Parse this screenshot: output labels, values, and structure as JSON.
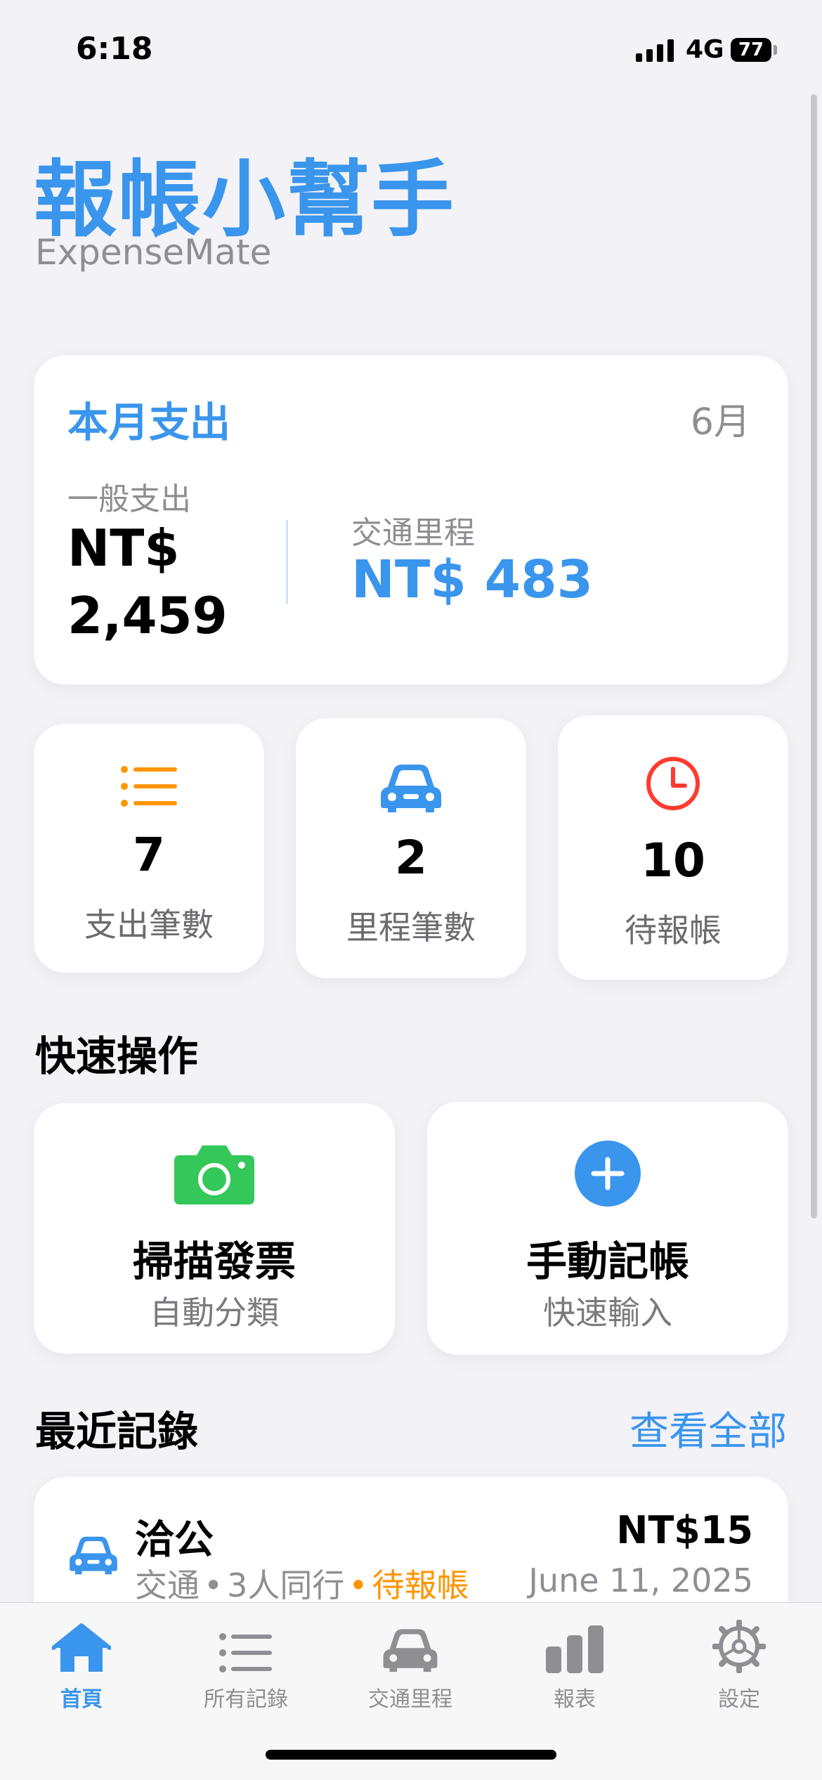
{
  "status_bar": {
    "time": "6:18",
    "network": "4G",
    "battery": "77"
  },
  "header": {
    "title": "報帳小幫手",
    "subtitle": "ExpenseMate"
  },
  "summary": {
    "title": "本月支出",
    "month": "6月",
    "general_label": "一般支出",
    "general_amount": "NT$ 2,459",
    "mileage_label": "交通里程",
    "mileage_amount": "NT$ 483"
  },
  "stats": [
    {
      "icon": "list-icon",
      "value": "7",
      "label": "支出筆數",
      "color": "#ff9500"
    },
    {
      "icon": "car-icon",
      "value": "2",
      "label": "里程筆數",
      "color": "#3a95ec"
    },
    {
      "icon": "clock-icon",
      "value": "10",
      "label": "待報帳",
      "color": "#ff3b30"
    }
  ],
  "quick_actions": {
    "title": "快速操作",
    "items": [
      {
        "icon": "camera-icon",
        "title": "掃描發票",
        "subtitle": "自動分類",
        "color": "#34c759"
      },
      {
        "icon": "plus-circle-icon",
        "title": "手動記帳",
        "subtitle": "快速輸入",
        "color": "#3a95ec"
      }
    ]
  },
  "recent": {
    "title": "最近記錄",
    "see_all": "查看全部",
    "items": [
      {
        "icon": "car-icon",
        "title": "洽公",
        "category": "交通",
        "people": "3人同行",
        "status": "待報帳",
        "amount": "NT$15",
        "date": "June 11, 2025"
      }
    ]
  },
  "tabbar": {
    "active_color": "#3a95ec",
    "items": [
      {
        "icon": "house-icon",
        "label": "首頁",
        "active": true
      },
      {
        "icon": "list-icon",
        "label": "所有記錄",
        "active": false
      },
      {
        "icon": "car-icon",
        "label": "交通里程",
        "active": false
      },
      {
        "icon": "bar-chart-icon",
        "label": "報表",
        "active": false
      },
      {
        "icon": "gear-icon",
        "label": "設定",
        "active": false
      }
    ]
  }
}
